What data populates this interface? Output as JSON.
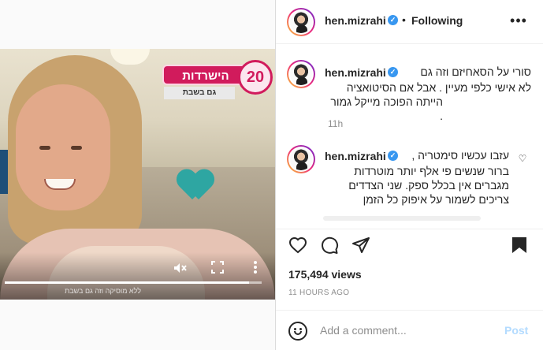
{
  "media": {
    "logo_main": "הישרדות",
    "logo_num": "20",
    "logo_sub": "גם בשבת",
    "progress": 0.95,
    "caption_fragment": "ללא מוסיקה וזה גם בשבת",
    "icons": {
      "mute": "mute-icon",
      "fullscreen": "fullscreen-icon",
      "more": "more-vertical-icon"
    }
  },
  "header": {
    "username": "hen.mizrahi",
    "dot": "•",
    "follow_status": "Following",
    "more": "•••"
  },
  "caption": {
    "username": "hen.mizrahi",
    "text_line1": "סורי על הסאחיזם וזה גם",
    "text_line2": "לא אישי כלפי מעיין . אבל אם הסיטואציה",
    "text_line3": "הייתה הפוכה מייקל גמור .",
    "time": "11h"
  },
  "comment": {
    "username": "hen.mizrahi",
    "text_line1": "עזבו עכשיו סימטריה ,",
    "text_line2": "ברור שנשים פי אלף יותר מוטרדות",
    "text_line3": "מגברים אין בכלל ספק. שני הצדדים",
    "text_line4": "צריכים לשמור על איפוק כל הזמן"
  },
  "stats": {
    "views": "175,494 views",
    "posted": "11 HOURS AGO"
  },
  "add_comment": {
    "placeholder": "Add a comment...",
    "post_label": "Post"
  },
  "colors": {
    "accent": "#3897f0",
    "post_disabled": "#b3dbff",
    "muted": "#8e8e8e"
  }
}
